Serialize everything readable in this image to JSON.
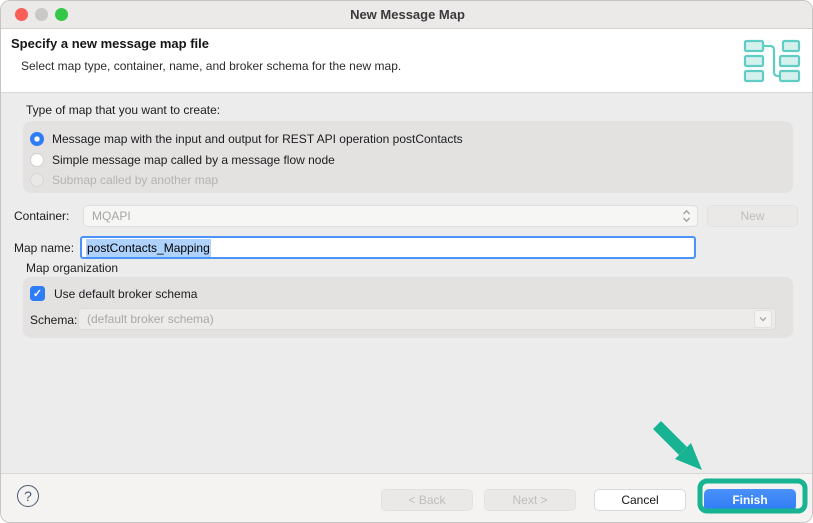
{
  "window": {
    "title": "New Message Map"
  },
  "titlebar_icons": [
    "close-button",
    "minimize-button",
    "zoom-button"
  ],
  "header": {
    "title": "Specify a new message map file",
    "subtitle": "Select map type, container, name, and broker schema for the new map.",
    "icon": "message-map-icon"
  },
  "map_type": {
    "label": "Type of map that you want to create:",
    "options": [
      {
        "label": "Message map with the input and output for REST API operation postContacts",
        "selected": true,
        "enabled": true
      },
      {
        "label": "Simple message map called by a message flow node",
        "selected": false,
        "enabled": true
      },
      {
        "label": "Submap called by another map",
        "selected": false,
        "enabled": false
      }
    ]
  },
  "container": {
    "label": "Container:",
    "value": "MQAPI",
    "enabled": false,
    "new_button": "New",
    "new_button_enabled": false
  },
  "map_name": {
    "label": "Map name:",
    "value": "postContacts_Mapping",
    "text_selected": true,
    "focused": true
  },
  "map_organization": {
    "label": "Map organization",
    "checkbox_label": "Use default broker schema",
    "checked": true,
    "schema_label": "Schema:",
    "schema_value": "(default broker schema)",
    "schema_enabled": false
  },
  "footer": {
    "back": "< Back",
    "next": "Next >",
    "cancel": "Cancel",
    "finish": "Finish",
    "back_enabled": false,
    "next_enabled": false
  },
  "icons": {
    "help": "?",
    "checkmark": "✓"
  },
  "annotation": {
    "type": "arrow-and-box-highlight",
    "target": "Finish button",
    "color": "#18b392"
  },
  "colors": {
    "accent_blue": "#2e7cf6",
    "annotation_teal": "#18b392",
    "icon_teal": "#5fcdc4",
    "selection_blue": "#aed2fb",
    "traffic_red": "#f95f57",
    "traffic_gray": "#c9c8c7",
    "traffic_green": "#34c748"
  }
}
